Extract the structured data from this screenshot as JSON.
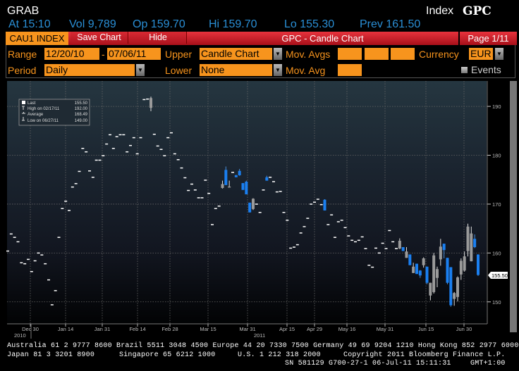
{
  "header": {
    "function": "GRAB",
    "security_type": "Index",
    "ticker": "GPC",
    "quote": {
      "at": "At 15:10",
      "vol": "Vol 9,789",
      "open": "Op 159.70",
      "high": "Hi 159.70",
      "low": "Lo 155.30",
      "prev": "Prev 161.50"
    }
  },
  "toolbar": {
    "security": "CAU1 INDEX",
    "save_chart": "Save Chart",
    "hide": "Hide",
    "title": "GPC - Candle Chart",
    "page": "Page 1/11"
  },
  "controls": {
    "range_label": "Range",
    "range_start": "12/20/10",
    "range_sep": "-",
    "range_end": "07/06/11",
    "upper_label": "Upper",
    "upper_value": "Candle Chart",
    "mov_avgs_label": "Mov. Avgs",
    "currency_label": "Currency",
    "currency_value": "EUR",
    "period_label": "Period",
    "period_value": "Daily",
    "lower_label": "Lower",
    "lower_value": "None",
    "mov_avg_label": "Mov. Avg",
    "events_label": "Events",
    "events_checked": false
  },
  "legend": [
    {
      "label": "Last",
      "value": "155.50",
      "icon": "square-icon"
    },
    {
      "label": "High on 02/17/11",
      "value": "192.00",
      "icon": "high-marker-icon"
    },
    {
      "label": "Average",
      "value": "168.49",
      "icon": "average-marker-icon"
    },
    {
      "label": "Low on 06/27/11",
      "value": "149.00",
      "icon": "low-marker-icon"
    }
  ],
  "chart_data": {
    "type": "candlestick",
    "period": "Daily",
    "ylim": [
      145.5,
      195.2
    ],
    "y_ticks": [
      "150",
      "160",
      "170",
      "180",
      "190"
    ],
    "last_label": "155.50",
    "x_ticks": [
      "Dec 30",
      "Jan 14",
      "Jan 31",
      "Feb 14",
      "Feb 28",
      "Mar 15",
      "Mar 31",
      "Apr 15",
      "Apr 29",
      "May 16",
      "May 31",
      "Jun 15",
      "Jun 30"
    ],
    "year_labels": [
      "2010",
      "2011"
    ],
    "grid": true,
    "colors": {
      "up": "#9a9a9a",
      "down": "#1a7ff0",
      "flat": "#ffffff"
    },
    "ohlc": [
      [
        160.4,
        160.4,
        160.4,
        160.4
      ],
      [
        163.9,
        163.9,
        163.9,
        163.9
      ],
      [
        163.2,
        163.2,
        163.2,
        163.2
      ],
      [
        162.3,
        162.3,
        162.3,
        162.3
      ],
      [
        158.0,
        158.0,
        158.0,
        158.0
      ],
      [
        157.8,
        157.8,
        157.8,
        157.8
      ],
      [
        158.7,
        158.7,
        158.7,
        158.7
      ],
      [
        156.2,
        156.2,
        156.2,
        156.2
      ],
      [
        158.4,
        158.4,
        158.4,
        158.4
      ],
      [
        160.0,
        160.0,
        160.0,
        160.0
      ],
      [
        159.6,
        159.6,
        159.6,
        159.6
      ],
      [
        157.8,
        157.8,
        157.8,
        157.8
      ],
      [
        154.5,
        154.5,
        154.5,
        154.5
      ],
      [
        149.4,
        149.4,
        149.4,
        149.4
      ],
      [
        152.3,
        152.3,
        152.3,
        152.3
      ],
      [
        163.2,
        163.2,
        163.2,
        163.2
      ],
      [
        169.1,
        169.1,
        169.1,
        169.1
      ],
      [
        170.6,
        170.6,
        170.6,
        170.6
      ],
      [
        168.7,
        168.7,
        168.7,
        168.7
      ],
      [
        173.5,
        173.5,
        173.5,
        173.5
      ],
      [
        174.2,
        174.2,
        174.2,
        174.2
      ],
      [
        176.7,
        176.7,
        176.7,
        176.7
      ],
      [
        181.4,
        181.4,
        181.4,
        181.4
      ],
      [
        180.7,
        180.7,
        180.7,
        180.7
      ],
      [
        176.8,
        176.8,
        176.8,
        176.8
      ],
      [
        175.5,
        175.5,
        175.5,
        175.5
      ],
      [
        179.0,
        179.0,
        179.0,
        179.0
      ],
      [
        179.0,
        179.0,
        179.0,
        179.0
      ],
      [
        179.9,
        179.9,
        179.9,
        179.9
      ],
      [
        182.3,
        182.3,
        182.3,
        182.3
      ],
      [
        184.2,
        184.2,
        184.2,
        184.2
      ],
      [
        181.4,
        181.4,
        181.4,
        181.4
      ],
      [
        183.8,
        183.8,
        183.8,
        183.8
      ],
      [
        184.2,
        184.2,
        184.2,
        184.2
      ],
      [
        184.2,
        184.2,
        184.2,
        184.2
      ],
      [
        180.7,
        180.7,
        180.7,
        180.7
      ],
      [
        182.0,
        182.0,
        182.0,
        182.0
      ],
      [
        183.6,
        183.6,
        183.6,
        183.6
      ],
      [
        180.3,
        180.3,
        180.3,
        180.3
      ],
      [
        183.6,
        183.6,
        183.6,
        183.6
      ],
      [
        191.4,
        191.4,
        191.4,
        191.4
      ],
      [
        191.5,
        191.5,
        191.5,
        191.5
      ],
      [
        189.7,
        192.0,
        189.0,
        191.7
      ],
      [
        184.3,
        184.3,
        184.3,
        184.3
      ],
      [
        181.9,
        181.9,
        181.9,
        181.9
      ],
      [
        181.2,
        181.2,
        181.2,
        181.2
      ],
      [
        179.9,
        179.9,
        179.9,
        179.9
      ],
      [
        183.6,
        183.6,
        183.6,
        183.6
      ],
      [
        184.6,
        184.6,
        184.6,
        184.6
      ],
      [
        180.3,
        180.3,
        180.3,
        180.3
      ],
      [
        179.1,
        179.1,
        179.1,
        179.1
      ],
      [
        177.4,
        177.4,
        177.4,
        177.4
      ],
      [
        175.4,
        175.4,
        175.4,
        175.4
      ],
      [
        172.8,
        172.8,
        172.8,
        172.8
      ],
      [
        174.1,
        174.1,
        174.1,
        174.1
      ],
      [
        172.9,
        172.9,
        172.9,
        172.9
      ],
      [
        171.3,
        171.3,
        171.3,
        171.3
      ],
      [
        171.3,
        171.3,
        171.3,
        171.3
      ],
      [
        174.9,
        174.9,
        174.9,
        174.9
      ],
      [
        172.2,
        172.2,
        172.2,
        172.2
      ],
      [
        165.8,
        165.8,
        165.8,
        165.8
      ],
      [
        169.1,
        169.1,
        169.1,
        169.1
      ],
      [
        169.6,
        169.6,
        169.6,
        169.6
      ],
      [
        173.3,
        174.8,
        173.2,
        174.1
      ],
      [
        177.0,
        177.7,
        173.9,
        173.9
      ],
      [
        173.4,
        174.8,
        173.4,
        173.6
      ],
      [
        176.5,
        176.5,
        176.5,
        176.5
      ],
      [
        175.9,
        176.0,
        175.5,
        175.5
      ],
      [
        176.8,
        177.2,
        175.8,
        175.9
      ],
      [
        174.3,
        174.3,
        172.9,
        172.9
      ],
      [
        174.6,
        174.8,
        172.0,
        172.0
      ],
      [
        170.3,
        170.3,
        168.3,
        168.3
      ],
      [
        169.0,
        171.2,
        168.8,
        171.1
      ],
      [
        170.0,
        170.0,
        170.0,
        170.0
      ],
      [
        168.3,
        168.3,
        168.3,
        168.3
      ],
      [
        172.9,
        172.9,
        172.9,
        172.9
      ],
      [
        175.5,
        175.8,
        174.8,
        174.8
      ],
      [
        175.5,
        175.5,
        175.5,
        175.5
      ],
      [
        174.6,
        174.6,
        174.6,
        174.6
      ],
      [
        172.5,
        172.5,
        172.5,
        172.5
      ],
      [
        172.6,
        172.6,
        172.6,
        172.6
      ],
      [
        168.3,
        168.3,
        168.3,
        168.3
      ],
      [
        166.7,
        166.7,
        166.7,
        166.7
      ],
      [
        161.0,
        161.0,
        161.0,
        161.0
      ],
      [
        161.2,
        161.2,
        161.2,
        161.2
      ],
      [
        161.7,
        161.7,
        161.7,
        161.7
      ],
      [
        164.1,
        164.1,
        164.1,
        164.1
      ],
      [
        165.4,
        165.4,
        165.4,
        165.4
      ],
      [
        167.1,
        167.1,
        167.1,
        167.1
      ],
      [
        170.0,
        170.0,
        170.0,
        170.0
      ],
      [
        170.4,
        170.4,
        170.4,
        170.4
      ],
      [
        171.0,
        171.0,
        171.0,
        171.0
      ],
      [
        169.9,
        169.9,
        169.9,
        169.9
      ],
      [
        170.9,
        171.0,
        168.7,
        168.7
      ],
      [
        165.8,
        165.8,
        165.8,
        165.8
      ],
      [
        167.8,
        167.8,
        167.8,
        167.8
      ],
      [
        163.2,
        163.2,
        163.2,
        163.2
      ],
      [
        166.4,
        166.4,
        166.4,
        166.4
      ],
      [
        166.7,
        166.7,
        166.7,
        166.7
      ],
      [
        165.2,
        165.2,
        165.2,
        165.2
      ],
      [
        163.5,
        163.5,
        163.5,
        163.5
      ],
      [
        162.6,
        162.6,
        162.6,
        162.6
      ],
      [
        162.3,
        162.3,
        162.3,
        162.3
      ],
      [
        162.6,
        162.6,
        162.6,
        162.6
      ],
      [
        163.3,
        163.3,
        163.3,
        163.3
      ],
      [
        160.9,
        160.9,
        160.9,
        160.9
      ],
      [
        157.5,
        157.5,
        157.5,
        157.5
      ],
      [
        157.1,
        157.1,
        157.1,
        157.1
      ],
      [
        161.0,
        161.0,
        161.0,
        161.0
      ],
      [
        160.0,
        160.0,
        160.0,
        160.0
      ],
      [
        162.0,
        162.0,
        162.0,
        162.0
      ],
      [
        160.9,
        160.9,
        160.9,
        160.9
      ],
      [
        164.6,
        164.6,
        164.6,
        164.6
      ],
      [
        162.3,
        162.3,
        162.3,
        162.3
      ],
      [
        160.9,
        160.9,
        160.9,
        160.9
      ],
      [
        160.9,
        163.0,
        160.8,
        162.5
      ],
      [
        161.2,
        161.2,
        160.4,
        160.4
      ],
      [
        159.0,
        161.2,
        159.0,
        160.3
      ],
      [
        159.7,
        159.7,
        157.5,
        157.5
      ],
      [
        155.9,
        158.0,
        155.9,
        157.2
      ],
      [
        157.8,
        157.8,
        155.7,
        155.7
      ],
      [
        156.4,
        156.5,
        154.9,
        155.4
      ],
      [
        157.5,
        159.1,
        157.0,
        158.9
      ],
      [
        157.2,
        157.2,
        153.6,
        153.9
      ],
      [
        151.3,
        153.9,
        150.3,
        153.9
      ],
      [
        152.0,
        160.0,
        151.7,
        159.5
      ],
      [
        154.9,
        157.2,
        153.0,
        156.7
      ],
      [
        158.7,
        162.9,
        157.4,
        161.3
      ],
      [
        161.9,
        161.9,
        158.9,
        160.6
      ],
      [
        159.0,
        159.0,
        153.6,
        153.9
      ],
      [
        157.1,
        157.1,
        149.0,
        149.3
      ],
      [
        150.6,
        152.0,
        149.2,
        151.8
      ],
      [
        151.0,
        155.2,
        150.1,
        155.0
      ],
      [
        155.6,
        158.9,
        154.5,
        158.4
      ],
      [
        156.4,
        160.3,
        156.2,
        159.3
      ],
      [
        160.4,
        166.0,
        159.3,
        165.4
      ],
      [
        158.3,
        165.4,
        158.3,
        164.0
      ],
      [
        162.9,
        163.8,
        161.0,
        161.2
      ],
      [
        159.7,
        159.7,
        155.3,
        155.5
      ]
    ]
  },
  "footer": {
    "line1": "Australia 61 2 9777 8600 Brazil 5511 3048 4500 Europe 44 20 7330 7500 Germany 49 69 9204 1210 Hong Kong 852 2977 6000",
    "line2_a": "Japan 81 3 3201 8900",
    "line2_b": "Singapore 65 6212 1000",
    "line2_c": "U.S. 1 212 318 2000",
    "line2_d": "Copyright 2011 Bloomberg Finance L.P.",
    "line3_a": "SN 581129 G700-27-1 06-Jul-11 15:11:31",
    "line3_b": "GMT+1:00"
  }
}
